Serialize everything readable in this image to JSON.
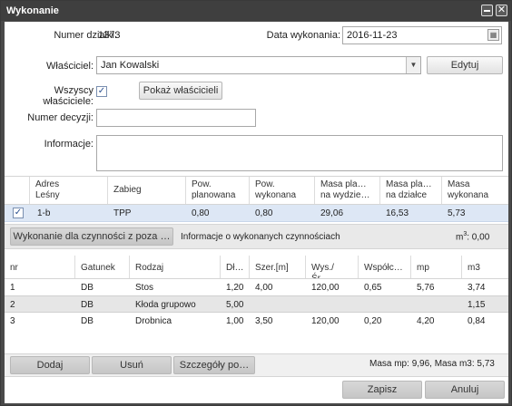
{
  "window": {
    "title": "Wykonanie"
  },
  "form": {
    "numer_dzialki_label": "Numer działki:",
    "numer_dzialki_value": "1373",
    "data_label": "Data wykonania:",
    "data_value": "2016-11-23",
    "wlasciciel_label": "Właściciel:",
    "wlasciciel_value": "Jan Kowalski",
    "edytuj": "Edytuj",
    "wszyscy_label_1": "Wszyscy",
    "wszyscy_label_2": "właściciele:",
    "pokaz": "Pokaż właścicieli",
    "decyzja_label": "Numer decyzji:",
    "decyzja_value": "",
    "informacje_label": "Informacje:",
    "informacje_value": ""
  },
  "grid1": {
    "headers": [
      [
        "Adres",
        "Leśny"
      ],
      [
        "Zabieg",
        ""
      ],
      [
        "Pow.",
        "planowana"
      ],
      [
        "Pow.",
        "wykonana"
      ],
      [
        "Masa pla…",
        "na wydzie…"
      ],
      [
        "Masa pla…",
        "na działce"
      ],
      [
        "Masa",
        "wykonana"
      ]
    ],
    "row": {
      "checked": true,
      "adres": "1-b",
      "zabieg": "TPP",
      "pow_plan": "0,80",
      "pow_wyk": "0,80",
      "masa_wydz": "29,06",
      "masa_dz": "16,53",
      "masa_wyk": "5,73"
    }
  },
  "toolbar1": {
    "btn": "Wykonanie dla czynności z poza …",
    "info": "Informacje o wykonanych czynnościach",
    "m3_label": "m",
    "m3_sup": "3",
    "m3_value": ": 0,00"
  },
  "grid2": {
    "headers": [
      "nr",
      "Gatunek",
      "Rodzaj",
      "Dł…",
      "Szer.[m]",
      "Wys./Śr.…",
      "Współc…",
      "mp",
      "m3"
    ],
    "rows": [
      {
        "nr": "1",
        "gatunek": "DB",
        "rodzaj": "Stos",
        "dl": "1,20",
        "szer": "4,00",
        "wys": "120,00",
        "wsp": "0,65",
        "mp": "5,76",
        "m3": "3,74"
      },
      {
        "nr": "2",
        "gatunek": "DB",
        "rodzaj": "Kłoda grupowo",
        "dl": "5,00",
        "szer": "",
        "wys": "",
        "wsp": "",
        "mp": "",
        "m3": "1,15"
      },
      {
        "nr": "3",
        "gatunek": "DB",
        "rodzaj": "Drobnica",
        "dl": "1,00",
        "szer": "3,50",
        "wys": "120,00",
        "wsp": "0,20",
        "mp": "4,20",
        "m3": "0,84"
      }
    ]
  },
  "bottom": {
    "dodaj": "Dodaj",
    "usun": "Usuń",
    "szczegoly": "Szczegóły po…",
    "masa_mp_label": "Masa mp:",
    "masa_mp_value": "9,96",
    "masa_m3_label": ", Masa m3:",
    "masa_m3_value": "5,73"
  },
  "footer": {
    "zapisz": "Zapisz",
    "anuluj": "Anuluj"
  }
}
